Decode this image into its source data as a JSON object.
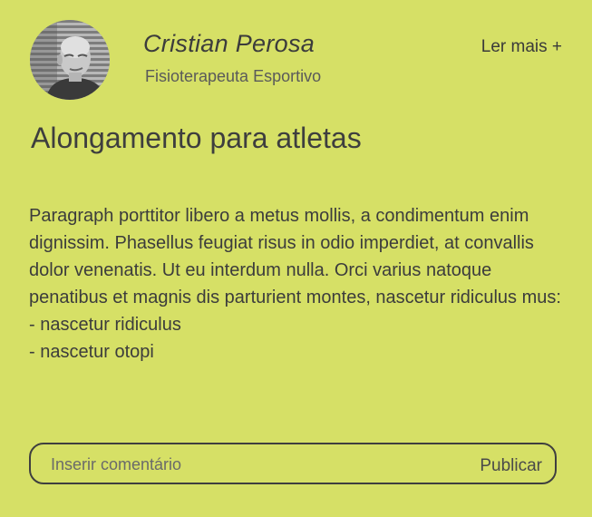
{
  "author": {
    "name": "Cristian Perosa",
    "role": "Fisioterapeuta Esportivo"
  },
  "header": {
    "read_more_label": "Ler mais +"
  },
  "post": {
    "title": "Alongamento para atletas",
    "paragraph": "Paragraph porttitor libero a metus mollis, a condimentum enim dignissim. Phasellus feugiat risus in odio imperdiet, at convallis dolor venenatis. Ut eu interdum nulla. Orci varius natoque penatibus et magnis dis parturient montes, nascetur ridiculus mus:",
    "list_items": [
      "- nascetur ridiculus",
      "- nascetur otopi"
    ]
  },
  "comment": {
    "placeholder": "Inserir comentário",
    "value": "",
    "publish_label": "Publicar"
  },
  "colors": {
    "background": "#d6e066",
    "text": "#3f3f3f"
  }
}
